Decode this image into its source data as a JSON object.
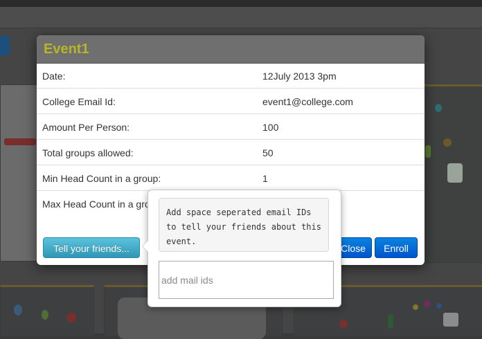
{
  "modal": {
    "title": "Event1",
    "rows": [
      {
        "label": "Date:",
        "value": "12July 2013 3pm"
      },
      {
        "label": "College Email Id:",
        "value": "event1@college.com"
      },
      {
        "label": "Amount Per Person:",
        "value": "100"
      },
      {
        "label": "Total groups allowed:",
        "value": "50"
      },
      {
        "label": "Min Head Count in a group:",
        "value": "1"
      },
      {
        "label": "Max Head Count in a group:",
        "value": ""
      }
    ],
    "buttons": {
      "tell_friends": "Tell your friends...",
      "close": "Close",
      "enroll": "Enroll"
    }
  },
  "popover": {
    "hint": "Add space seperated email IDs to tell your friends about this event.",
    "input_value": "",
    "input_placeholder": "add mail ids"
  },
  "colors": {
    "title": "#b7b52a",
    "header_bg": "#6f6f6f",
    "primary_button": "#0055cc",
    "info_button": "#2f96b4"
  }
}
